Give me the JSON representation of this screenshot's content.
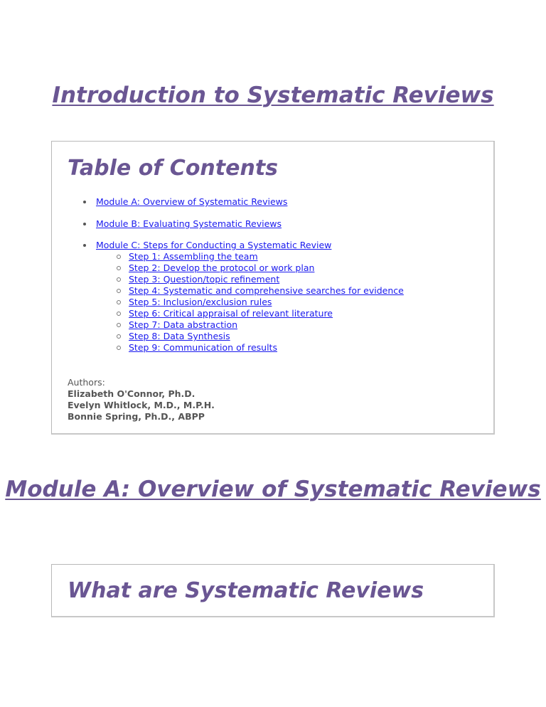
{
  "main_title": "Introduction to Systematic Reviews",
  "toc": {
    "heading": "Table of Contents",
    "items": [
      {
        "label": "Module A: Overview of Systematic Reviews"
      },
      {
        "label": "Module B: Evaluating Systematic Reviews"
      },
      {
        "label": "Module C: Steps for Conducting a Systematic Review",
        "steps": [
          "Step 1: Assembling the team",
          "Step 2: Develop the protocol or work plan",
          "Step 3: Question/topic refinement",
          "Step 4: Systematic and comprehensive searches for evidence",
          "Step 5: Inclusion/exclusion rules",
          "Step 6: Critical appraisal of relevant literature",
          "Step 7: Data abstraction",
          "Step 8: Data Synthesis",
          "Step 9: Communication of results"
        ]
      }
    ],
    "authors_label": "Authors:",
    "authors": [
      "Elizabeth O'Connor, Ph.D.",
      "Evelyn Whitlock, M.D., M.P.H.",
      "Bonnie Spring, Ph.D., ABPP"
    ]
  },
  "moduleA": {
    "title": "Module A: Overview of Systematic Reviews",
    "section_heading": "What are Systematic Reviews"
  },
  "colors": {
    "heading_purple": "#6a5693",
    "link_blue": "#1a1aee",
    "author_gray": "#555555"
  }
}
